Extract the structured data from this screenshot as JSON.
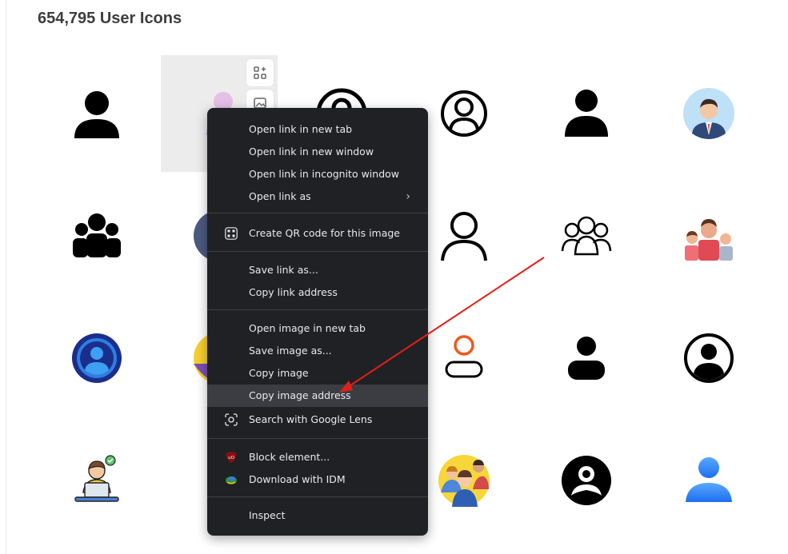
{
  "header": {
    "title": "654,795 User Icons"
  },
  "icons": [
    "person-solid-icon",
    "person-pastel-icon",
    "user-circle-outline-icon",
    "user-circle-outline-icon",
    "person-solid-icon",
    "businessman-avatar-icon",
    "group-solid-icon",
    "avatar-partial-icon",
    "",
    "person-outline-icon",
    "group-outline-icon",
    "family-avatar-icon",
    "user-circle-blue-icon",
    "avatar-yellow-partial-icon",
    "",
    "person-orange-outline-icon",
    "person-solid-icon",
    "user-circle-solid-icon",
    "laptop-user-icon",
    "lock-partial-icon",
    "",
    "team-avatar-icon",
    "user-circle-solid-icon",
    "person-blue-icon"
  ],
  "context_menu": {
    "items": [
      {
        "label": "Open link in new tab"
      },
      {
        "label": "Open link in new window"
      },
      {
        "label": "Open link in incognito window"
      },
      {
        "label": "Open link as",
        "submenu": true
      },
      {
        "label": "Create QR code for this image",
        "icon": "qr-code-icon"
      },
      {
        "label": "Save link as..."
      },
      {
        "label": "Copy link address"
      },
      {
        "label": "Open image in new tab"
      },
      {
        "label": "Save image as..."
      },
      {
        "label": "Copy image"
      },
      {
        "label": "Copy image address",
        "highlighted": true
      },
      {
        "label": "Search with Google Lens",
        "icon": "google-lens-icon"
      },
      {
        "label": "Block element...",
        "icon": "ublock-shield-icon"
      },
      {
        "label": "Download with IDM",
        "icon": "idm-icon"
      },
      {
        "label": "Inspect"
      }
    ]
  },
  "colors": {
    "menu_bg": "#202124",
    "menu_highlight": "#3b3d42",
    "annotation_arrow": "#e0201b"
  }
}
